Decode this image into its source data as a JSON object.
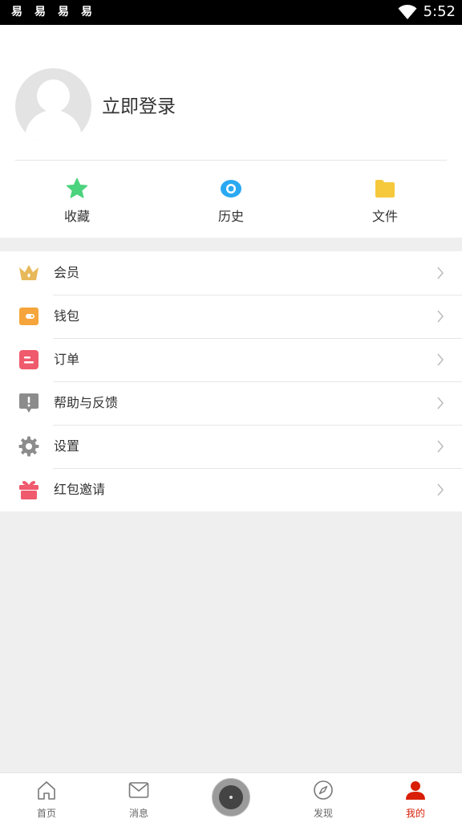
{
  "status_bar": {
    "time": "5:52",
    "notification_icons": [
      "app-notification-icon",
      "app-notification-icon",
      "app-notification-icon",
      "app-notification-icon"
    ],
    "notification_glyph": "易",
    "wifi_icon": "wifi-icon"
  },
  "profile": {
    "login_label": "立即登录",
    "quick_actions": [
      {
        "label": "收藏",
        "icon": "star-icon",
        "color": "#4cd37d"
      },
      {
        "label": "历史",
        "icon": "eye-icon",
        "color": "#2aa9f2"
      },
      {
        "label": "文件",
        "icon": "folder-icon",
        "color": "#f5c93b"
      }
    ]
  },
  "menu": {
    "items": [
      {
        "label": "会员",
        "icon": "crown-icon",
        "color": "#e8b95a"
      },
      {
        "label": "钱包",
        "icon": "wallet-icon",
        "color": "#f5a53b"
      },
      {
        "label": "订单",
        "icon": "order-icon",
        "color": "#ef5a6c"
      },
      {
        "label": "帮助与反馈",
        "icon": "help-feedback-icon",
        "color": "#8c8c8c"
      },
      {
        "label": "设置",
        "icon": "gear-icon",
        "color": "#8c8c8c"
      },
      {
        "label": "红包邀请",
        "icon": "gift-icon",
        "color": "#ef5a6c"
      }
    ]
  },
  "bottom_nav": {
    "items": [
      {
        "label": "首页",
        "icon": "home-icon"
      },
      {
        "label": "消息",
        "icon": "mail-icon"
      },
      {
        "label": "发现",
        "icon": "compass-icon"
      },
      {
        "label": "我的",
        "icon": "user-icon",
        "active": true
      }
    ],
    "active_color": "#d81e06"
  }
}
